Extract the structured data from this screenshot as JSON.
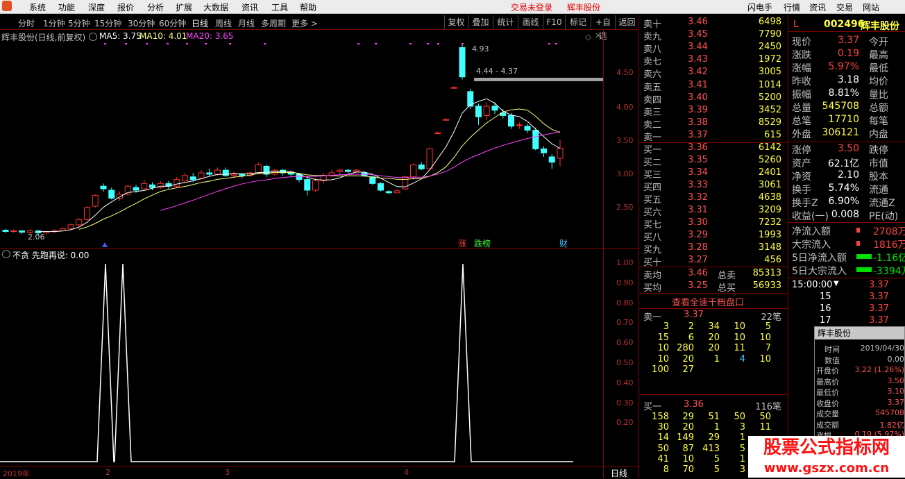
{
  "menubar": {
    "logo": "",
    "items": [
      "系统",
      "功能",
      "深度",
      "报价",
      "分析",
      "扩展",
      "大数据",
      "资讯",
      "工具",
      "帮助"
    ],
    "status": "交易未登录",
    "stock_name": "辉丰股份",
    "right_items": [
      "闪电手",
      "行情",
      "资讯",
      "交易",
      "网站"
    ]
  },
  "toolbar": {
    "periods": [
      "分时",
      "1分钟",
      "5分钟",
      "15分钟",
      "30分钟",
      "60分钟",
      "日线",
      "周线",
      "月线",
      "多周期",
      "更多 >"
    ],
    "selected": "日线",
    "buttons": [
      "复权",
      "叠加",
      "统计",
      "画线",
      "F10",
      "标记",
      "+自选",
      "返回"
    ]
  },
  "chart": {
    "title": "辉丰股份(日线,前复权)",
    "ma5": "MA5: 3.75",
    "ma10": "MA10: 4.01",
    "ma20": "MA20: 3.65",
    "high_label": "4.93",
    "range_label": "4.44 - 4.37",
    "low_label": "2.06",
    "y_ticks": [
      "4.50",
      "4.00",
      "3.50",
      "3.00",
      "2.50"
    ],
    "markers": [
      "涨",
      "跌榜",
      "财"
    ],
    "colors": {
      "up": "#ff3030",
      "down": "#40ffff",
      "ma5": "#ffffff",
      "ma10": "#ffff80",
      "ma20": "#ff40ff"
    }
  },
  "indicator": {
    "title": "不贪  先跑再说: 0.00",
    "y_ticks": [
      "1.00",
      "0.90",
      "0.80",
      "0.70",
      "0.60",
      "0.50",
      "0.40",
      "0.30",
      "0.20"
    ],
    "x_labels": [
      "2019年",
      "2",
      "3",
      "4"
    ],
    "period_label": "日线"
  },
  "orderbook": {
    "asks": [
      {
        "label": "卖十",
        "price": "3.46",
        "vol": "6498"
      },
      {
        "label": "卖九",
        "price": "3.45",
        "vol": "7790"
      },
      {
        "label": "卖八",
        "price": "3.44",
        "vol": "2450"
      },
      {
        "label": "卖七",
        "price": "3.43",
        "vol": "1972"
      },
      {
        "label": "卖六",
        "price": "3.42",
        "vol": "3005"
      },
      {
        "label": "卖五",
        "price": "3.41",
        "vol": "1014"
      },
      {
        "label": "卖四",
        "price": "3.40",
        "vol": "5200"
      },
      {
        "label": "卖三",
        "price": "3.39",
        "vol": "3452"
      },
      {
        "label": "卖二",
        "price": "3.38",
        "vol": "8529"
      },
      {
        "label": "卖一",
        "price": "3.37",
        "vol": "615"
      }
    ],
    "bids": [
      {
        "label": "买一",
        "price": "3.36",
        "vol": "6142"
      },
      {
        "label": "买二",
        "price": "3.35",
        "vol": "5260"
      },
      {
        "label": "买三",
        "price": "3.34",
        "vol": "2401"
      },
      {
        "label": "买四",
        "price": "3.33",
        "vol": "3061"
      },
      {
        "label": "买五",
        "price": "3.32",
        "vol": "4638"
      },
      {
        "label": "买六",
        "price": "3.31",
        "vol": "3209"
      },
      {
        "label": "买七",
        "price": "3.30",
        "vol": "7232"
      },
      {
        "label": "买八",
        "price": "3.29",
        "vol": "1993"
      },
      {
        "label": "买九",
        "price": "3.28",
        "vol": "3148"
      },
      {
        "label": "买十",
        "price": "3.27",
        "vol": "456"
      }
    ],
    "avg_sell_label": "卖均",
    "avg_sell": "3.46",
    "total_sell_label": "总卖",
    "total_sell": "85313",
    "avg_buy_label": "买均",
    "avg_buy": "3.25",
    "total_buy_label": "总买",
    "total_buy": "56933",
    "full_depth_link": "查看全速千档盘口",
    "ask1_label": "卖一",
    "ask1_price": "3.37",
    "ask1_count": "22笔",
    "ask1_queue": [
      [
        "3",
        "2",
        "34",
        "10",
        "5"
      ],
      [
        "15",
        "6",
        "20",
        "10",
        "10"
      ],
      [
        "10",
        "280",
        "20",
        "11",
        "7"
      ],
      [
        "10",
        "20",
        "1",
        "4",
        "10"
      ],
      [
        "100",
        "27",
        "",
        "",
        ""
      ]
    ],
    "bid1_label": "买一",
    "bid1_price": "3.36",
    "bid1_count": "116笔",
    "bid1_queue": [
      [
        "158",
        "29",
        "51",
        "50",
        "50"
      ],
      [
        "30",
        "20",
        "1",
        "3",
        "11"
      ],
      [
        "14",
        "149",
        "29",
        "1",
        ""
      ],
      [
        "50",
        "87",
        "413",
        "5",
        ""
      ],
      [
        "41",
        "10",
        "5",
        "1",
        ""
      ],
      [
        "8",
        "70",
        "5",
        "3",
        ""
      ]
    ]
  },
  "quote": {
    "flag": "L",
    "code": "002496",
    "name": "辉丰股份",
    "rows": [
      {
        "l": "现价",
        "v": "3.37",
        "r": "今开"
      },
      {
        "l": "涨跌",
        "v": "0.19",
        "r": "最高"
      },
      {
        "l": "涨幅",
        "v": "5.97%",
        "r": "最低"
      },
      {
        "l": "昨收",
        "v": "3.18",
        "r": "均价"
      },
      {
        "l": "振幅",
        "v": "8.81%",
        "r": "量比"
      },
      {
        "l": "总量",
        "v": "545708",
        "r": "总额"
      },
      {
        "l": "总笔",
        "v": "17710",
        "r": "每笔"
      },
      {
        "l": "外盘",
        "v": "306121",
        "r": "内盘"
      }
    ],
    "rows2": [
      {
        "l": "涨停",
        "v": "3.50",
        "r": "跌停"
      },
      {
        "l": "资产",
        "v": "62.1亿",
        "r": "市值"
      },
      {
        "l": "净资",
        "v": "2.10",
        "r": "股本"
      },
      {
        "l": "换手",
        "v": "5.74%",
        "r": "流通"
      },
      {
        "l": "换手Z",
        "v": "6.90%",
        "r": "流通Z"
      },
      {
        "l": "收益(一)",
        "v": "0.008",
        "r": "PE(动)"
      }
    ],
    "flows": [
      {
        "l": "净流入额",
        "v": "2708万"
      },
      {
        "l": "大宗流入",
        "v": "1816万"
      },
      {
        "l": "5日净流入额",
        "v": "-1.16亿"
      },
      {
        "l": "5日大宗流入",
        "v": "-3394万"
      }
    ],
    "ticks": [
      {
        "t": "15:00:00",
        "p": "3.37"
      },
      {
        "t": "15",
        "p": "3.37"
      },
      {
        "t": "16",
        "p": "3.37"
      },
      {
        "t": "17",
        "p": "3.37"
      }
    ]
  },
  "tooltip": {
    "title": "辉丰股份",
    "rows": [
      {
        "l": "时间",
        "v": "2019/04/30"
      },
      {
        "l": "数值",
        "v": "0.00"
      },
      {
        "l": "开盘价",
        "v": "3.22 (1.26%)"
      },
      {
        "l": "最高价",
        "v": "3.50"
      },
      {
        "l": "最低价",
        "v": "3.10"
      },
      {
        "l": "收盘价",
        "v": "3.37"
      },
      {
        "l": "成交量",
        "v": "545708"
      },
      {
        "l": "成交额",
        "v": "1.82亿"
      },
      {
        "l": "涨幅",
        "v": "0.19 (5.97%)"
      }
    ]
  },
  "watermark": {
    "line1": "股票公式指标网",
    "line2": "www.gszx.com.cn"
  }
}
